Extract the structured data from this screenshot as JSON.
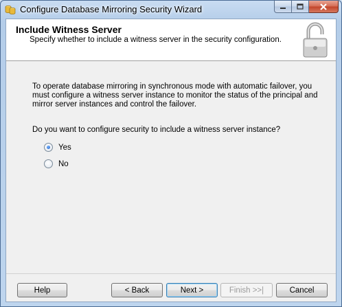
{
  "window": {
    "title": "Configure Database Mirroring Security Wizard"
  },
  "header": {
    "title": "Include Witness Server",
    "subtitle": "Specify whether to include a witness server in the security configuration."
  },
  "body": {
    "description": "To operate database mirroring in synchronous mode with automatic failover, you must configure a witness server instance to monitor the status of the principal and mirror server instances and control the failover.",
    "question": "Do you want to configure security to include a witness server instance?",
    "options": [
      {
        "label": "Yes",
        "selected": true
      },
      {
        "label": "No",
        "selected": false
      }
    ]
  },
  "buttons": {
    "help": "Help",
    "back": "< Back",
    "next": "Next >",
    "finish": "Finish >>|",
    "cancel": "Cancel"
  },
  "icons": {
    "app": "database-mirroring-icon",
    "header": "padlock-icon"
  }
}
